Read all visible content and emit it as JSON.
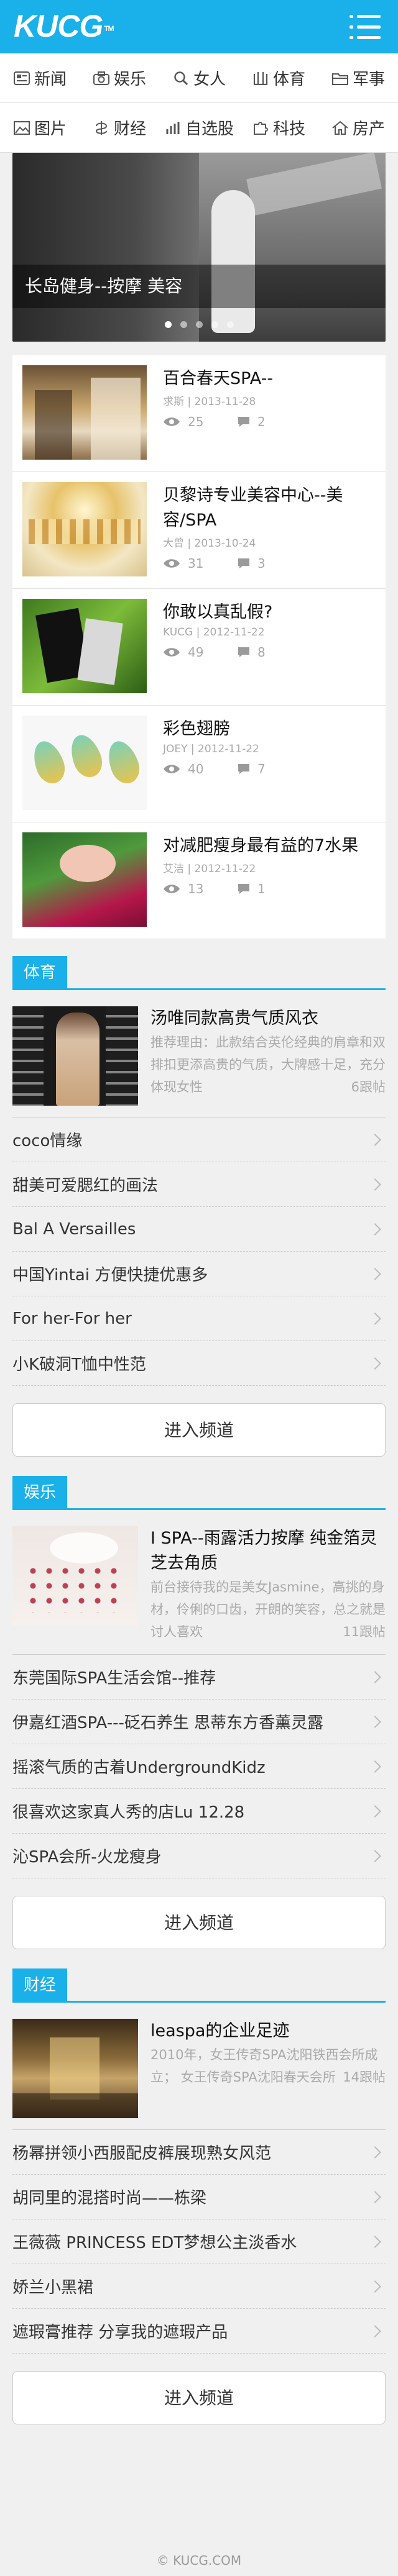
{
  "header": {
    "logo": "KUCG",
    "logo_tm": "TM",
    "menu_icon": "menu-icon"
  },
  "nav": [
    [
      {
        "label": "新闻",
        "icon": "news-icon"
      },
      {
        "label": "娱乐",
        "icon": "camera-icon"
      },
      {
        "label": "女人",
        "icon": "search-icon"
      },
      {
        "label": "体育",
        "icon": "columns-icon"
      },
      {
        "label": "军事",
        "icon": "folder-icon"
      }
    ],
    [
      {
        "label": "图片",
        "icon": "image-icon"
      },
      {
        "label": "财经",
        "icon": "dollar-icon"
      },
      {
        "label": "自选股",
        "icon": "bars-icon"
      },
      {
        "label": "科技",
        "icon": "puzzle-icon"
      },
      {
        "label": "房产",
        "icon": "home-icon"
      }
    ]
  ],
  "slider": {
    "caption": "长岛健身--按摩 美容",
    "dots": 5,
    "active": 0
  },
  "articles": [
    {
      "title": "百合春天SPA--",
      "meta": "求斯 | 2013-11-28",
      "views": "25",
      "comments": "2"
    },
    {
      "title": "贝黎诗专业美容中心--美容/SPA",
      "meta": "大曾 | 2013-10-24",
      "views": "31",
      "comments": "3"
    },
    {
      "title": "你敢以真乱假?",
      "meta": "KUCG | 2012-11-22",
      "views": "49",
      "comments": "8"
    },
    {
      "title": "彩色翅膀",
      "meta": "JOEY | 2012-11-22",
      "views": "40",
      "comments": "7"
    },
    {
      "title": "对减肥瘦身最有益的7水果",
      "meta": "艾洁 | 2012-11-22",
      "views": "13",
      "comments": "1"
    }
  ],
  "sections": [
    {
      "tag": "体育",
      "feature": {
        "title": "汤唯同款高贵气质风衣",
        "desc": "推荐理由：此款结合英伦经典的肩章和双排扣更添高贵的气质，大牌感十足，充分体现女性",
        "replies": "6跟帖"
      },
      "rows": [
        "coco情缘",
        "甜美可爱腮红的画法",
        "Bal A Versailles",
        "中国Yintai 方便快捷优惠多",
        "For her-For her",
        "小K破洞T恤中性范"
      ],
      "enter": "进入频道"
    },
    {
      "tag": "娱乐",
      "feature": {
        "title": "I SPA--雨露活力按摩 纯金箔灵芝去角质",
        "desc": "前台接待我的是美女Jasmine，高挑的身材，伶俐的口齿，开朗的笑容，总之就是讨人喜欢",
        "replies": "11跟帖"
      },
      "rows": [
        "东莞国际SPA生活会馆--推荐",
        "伊嘉红酒SPA---砭石养生 思蒂东方香薰灵露",
        "摇滚气质的古着UndergroundKidz",
        "很喜欢这家真人秀的店Lu 12.28",
        "沁SPA会所-火龙瘦身"
      ],
      "enter": "进入频道"
    },
    {
      "tag": "财经",
      "feature": {
        "title": "leaspa的企业足迹",
        "desc": "2010年，女王传奇SPA沈阳铁西会所成立； 女王传奇SPA沈阳春天会所",
        "replies": "14跟帖"
      },
      "rows": [
        "杨幂拼领小西服配皮裤展现熟女风范",
        "胡同里的混搭时尚——栋梁",
        "王薇薇 PRINCESS EDT梦想公主淡香水",
        "娇兰小黑裙",
        "遮瑕膏推荐 分享我的遮瑕产品"
      ],
      "enter": "进入频道"
    }
  ],
  "footer": "© KUCG.COM"
}
